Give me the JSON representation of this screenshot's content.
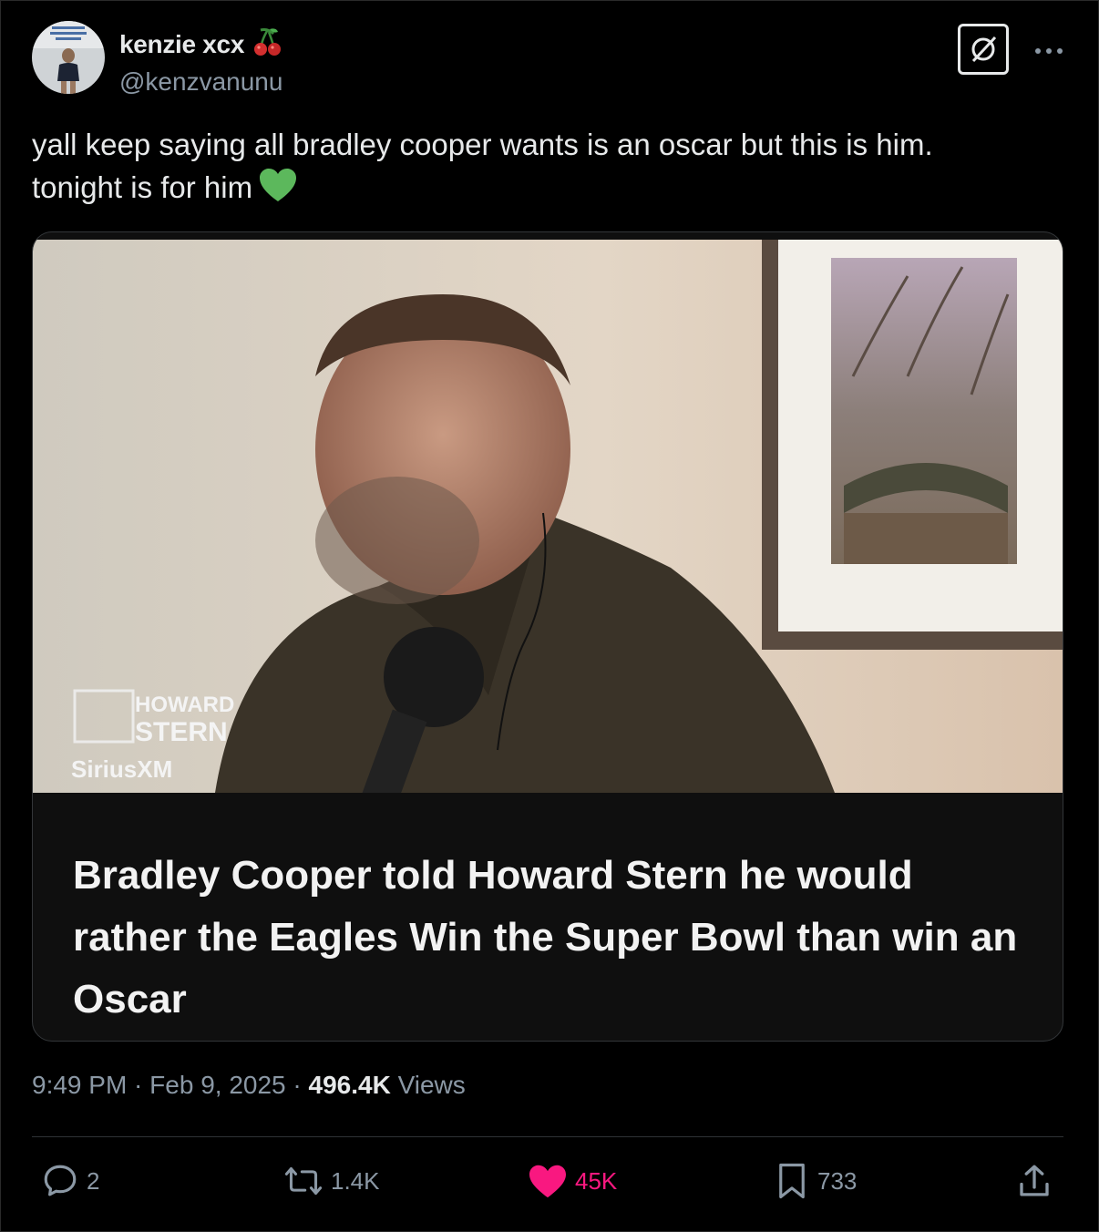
{
  "author": {
    "display_name": "kenzie xcx",
    "name_emoji": "cherries-icon",
    "handle": "@kenzvanunu"
  },
  "tweet": {
    "text_line1": "yall keep saying all bradley cooper wants is an oscar but this is him.",
    "text_line2": "tonight is for him",
    "emoji": "green-heart-icon"
  },
  "card": {
    "media_overlay": {
      "line1": "HOWARD",
      "line2": "STERN",
      "line3": "SiriusXM"
    },
    "caption": "Bradley Cooper told Howard Stern he would rather the Eagles Win the Super Bowl than win an Oscar"
  },
  "meta": {
    "time": "9:49 PM",
    "separator1": " · ",
    "date": "Feb 9, 2025",
    "separator2": " · ",
    "views_count": "496.4K",
    "views_label": " Views"
  },
  "actions": {
    "replies": "2",
    "reposts": "1.4K",
    "likes": "45K",
    "bookmarks": "733"
  },
  "colors": {
    "background": "#000000",
    "text_primary": "#e7e9ea",
    "text_secondary": "#8b98a5",
    "like": "#f91880",
    "green_heart": "#5cb85c"
  }
}
